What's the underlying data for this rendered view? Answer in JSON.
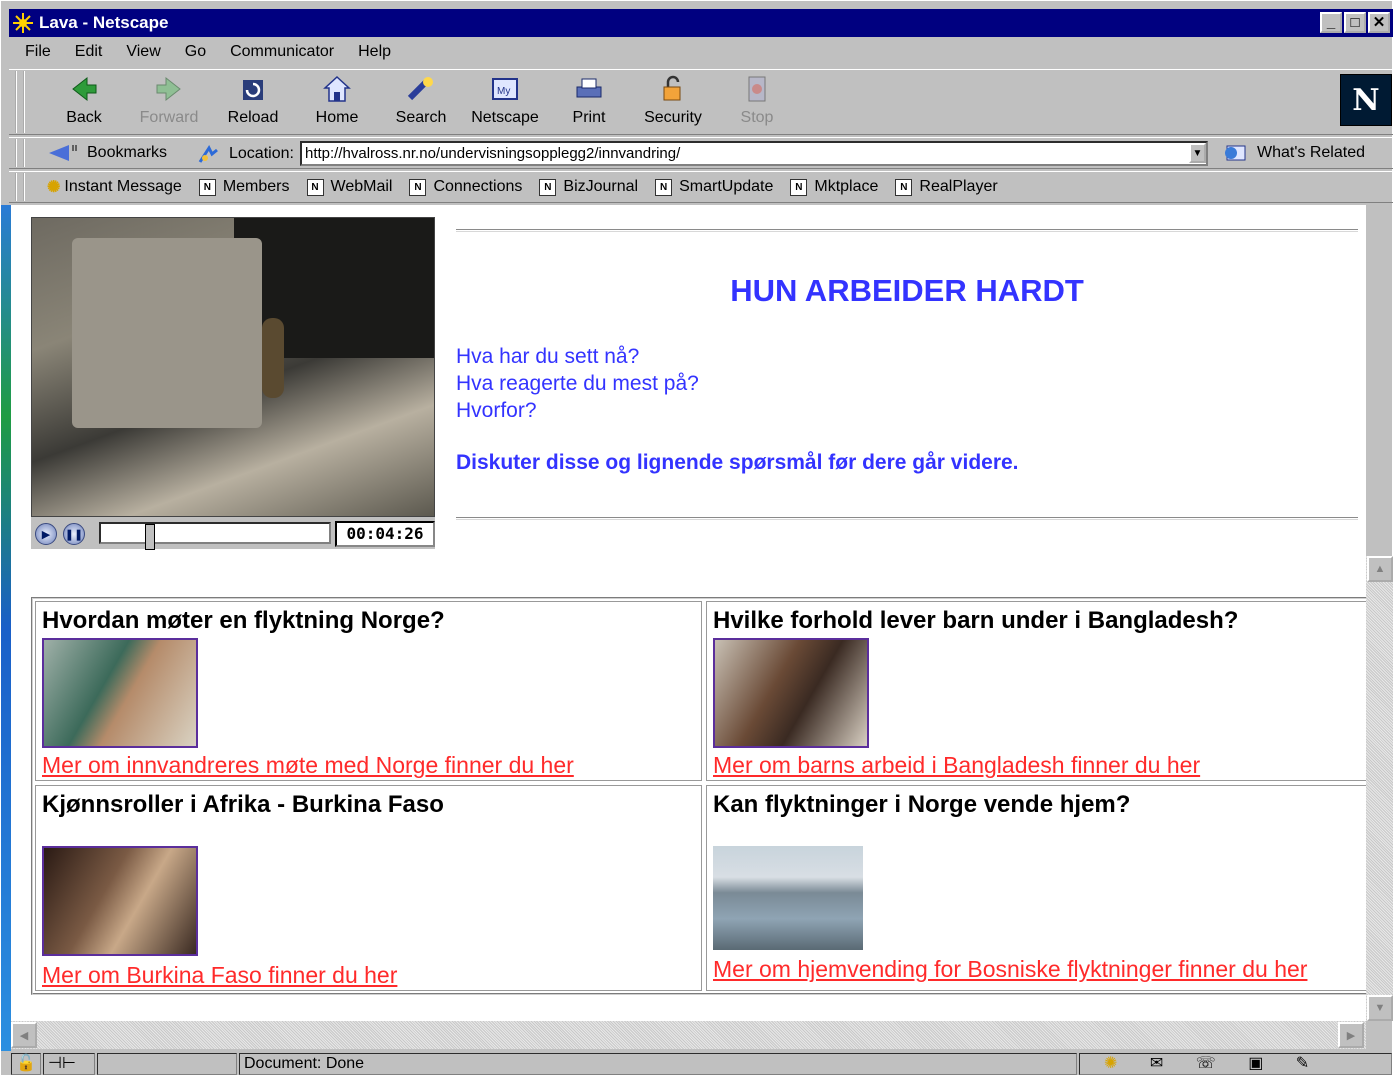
{
  "window": {
    "title": "Lava - Netscape"
  },
  "menu": [
    "File",
    "Edit",
    "View",
    "Go",
    "Communicator",
    "Help"
  ],
  "nav": {
    "back": "Back",
    "forward": "Forward",
    "reload": "Reload",
    "home": "Home",
    "search": "Search",
    "netscape": "Netscape",
    "print": "Print",
    "security": "Security",
    "stop": "Stop",
    "logo": "N"
  },
  "location": {
    "bookmarks": "Bookmarks",
    "label": "Location:",
    "url": "http://hvalross.nr.no/undervisningsopplegg2/innvandring/",
    "related": "What's Related"
  },
  "personal": [
    "Instant Message",
    "Members",
    "WebMail",
    "Connections",
    "BizJournal",
    "SmartUpdate",
    "Mktplace",
    "RealPlayer"
  ],
  "video": {
    "time": "00:04:26",
    "progress": 0.2
  },
  "page": {
    "headline": "HUN ARBEIDER HARDT",
    "q1": "Hva har du sett nå?",
    "q2": "Hva reagerte du mest på?",
    "q3": "Hvorfor?",
    "discuss": "Diskuter disse og lignende spørsmål før dere går videre."
  },
  "cells": [
    {
      "title": "Hvordan møter en flyktning Norge?",
      "link": "Mer om innvandreres møte med Norge finner du her"
    },
    {
      "title": "Hvilke forhold lever barn under i Bangladesh?",
      "link": "Mer om barns arbeid i Bangladesh finner du her"
    },
    {
      "title": "Kjønnsroller i Afrika - Burkina Faso",
      "link": "Mer om Burkina Faso finner du her"
    },
    {
      "title": "Kan flyktninger i Norge vende hjem?",
      "link": "Mer om hjemvending for Bosniske flyktninger finner du her"
    }
  ],
  "status": {
    "text": "Document: Done"
  },
  "colors": {
    "title_bar": "#000080",
    "headline": "#3333ff",
    "link": "#ff2a2a",
    "thumb_border": "#5b2e9c"
  }
}
